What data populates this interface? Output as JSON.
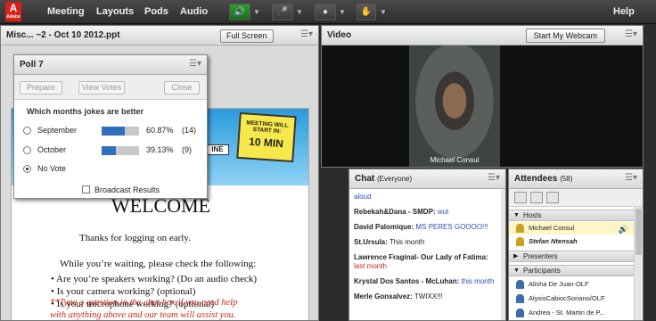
{
  "menubar": {
    "logo": "Adobe",
    "items": [
      "Meeting",
      "Layouts",
      "Pods",
      "Audio"
    ],
    "help": "Help"
  },
  "share": {
    "title": "Misc... ~2 - Oct 10 2012.ppt",
    "fullscreen": "Full Screen",
    "slide": {
      "sign_line1": "MEETING WILL START IN:",
      "sign_line2": "10 MIN",
      "tag": "INE",
      "welcome": "WELCOME",
      "line1": "Thanks for logging on early.",
      "line2": "While you’re waiting, please check the following:",
      "bullet1": "• Are you’re speakers working? (Do an audio check)",
      "bullet2": "• Is your camera working? (optional)",
      "bullet3": "• Is your microphone working? (optional)",
      "note1": "**Type a question in the chat box if you need help",
      "note2": "with anything above and our team will assist you."
    }
  },
  "poll": {
    "title": "Poll 7",
    "buttons": {
      "prepare": "Prepare",
      "view_votes": "View Votes",
      "close": "Close"
    },
    "question": "Which months jokes are better",
    "options": [
      {
        "label": "September",
        "pct": "60.87%",
        "count": "(14)",
        "value": 0.6087
      },
      {
        "label": "October",
        "pct": "39.13%",
        "count": "(9)",
        "value": 0.3913
      },
      {
        "label": "No Vote",
        "pct": "",
        "count": ""
      }
    ],
    "broadcast": "Broadcast Results"
  },
  "video": {
    "title": "Video",
    "webcam_btn": "Start My Webcam",
    "caption": "Michael Consul"
  },
  "chat": {
    "title": "Chat",
    "scope": "(Everyone)",
    "messages": [
      {
        "from": "",
        "text": "aloud",
        "color": "blue"
      },
      {
        "from": "Rebekah&Dana - SMDP:",
        "text": "wut",
        "color": "blue"
      },
      {
        "from": "David Palomique:",
        "text": "MS PERES GOOOO!!!",
        "color": "blue"
      },
      {
        "from": "St.Ursula:",
        "text": "This month",
        "color": "black"
      },
      {
        "from": "Lawrence Fraginal- Our Lady of Fatima:",
        "text": "last month",
        "color": "red"
      },
      {
        "from": "Krystal Dos Santos - McLuhan:",
        "text": "this month",
        "color": "blue"
      },
      {
        "from": "Merle Gonsalvez:",
        "text": "TWIXX!!!",
        "color": "black"
      }
    ]
  },
  "attendees": {
    "title": "Attendees",
    "count": "(58)",
    "hosts_label": "Hosts",
    "hosts": [
      "Michael Consul",
      "Stefan Ntensah"
    ],
    "presenters_label": "Presenters",
    "participants_label": "Participants",
    "participants": [
      "Alisha De Juan-OLF",
      "AlyxisCabiocSoriano/OLF",
      "Andrea - St. Martin de P..."
    ]
  }
}
